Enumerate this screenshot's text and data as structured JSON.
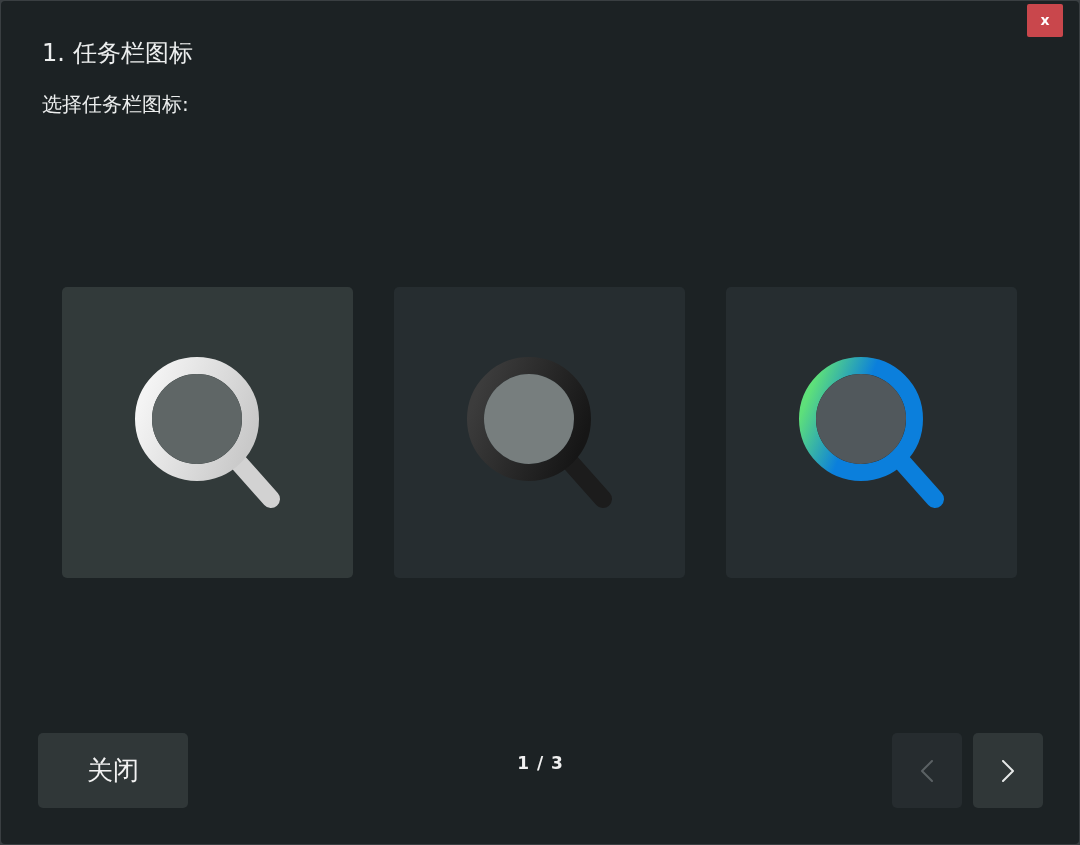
{
  "dialog": {
    "title": "1. 任务栏图标",
    "prompt": "选择任务栏图标:",
    "close_label": "x"
  },
  "options": [
    {
      "kind": "light",
      "selected": true
    },
    {
      "kind": "dark",
      "selected": false
    },
    {
      "kind": "color",
      "selected": false
    }
  ],
  "footer": {
    "close_button": "关闭",
    "page_indicator": "1 / 3",
    "prev": {
      "disabled": true
    },
    "next": {
      "disabled": false
    }
  }
}
